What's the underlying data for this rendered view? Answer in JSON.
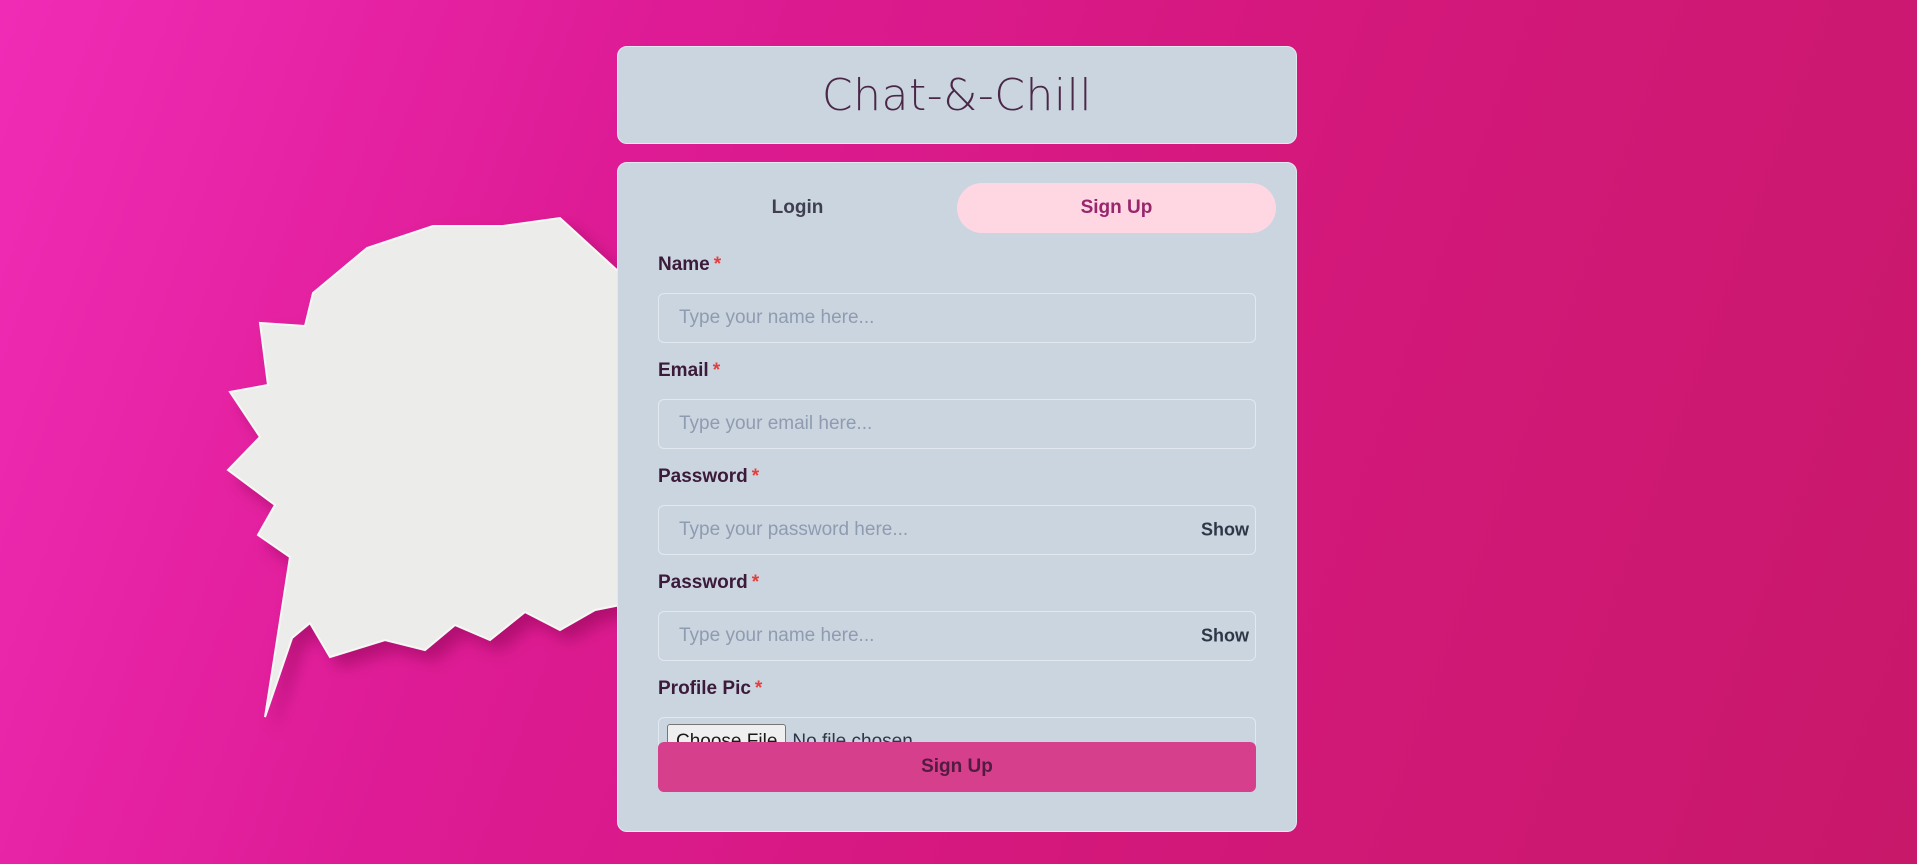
{
  "app": {
    "title": "Chat-&-Chill"
  },
  "tabs": [
    {
      "label": "Login",
      "active": false
    },
    {
      "label": "Sign Up",
      "active": true
    }
  ],
  "form": {
    "fields": [
      {
        "label": "Name",
        "required_mark": "*",
        "placeholder": "Type your name here...",
        "value": ""
      },
      {
        "label": "Email",
        "required_mark": "*",
        "placeholder": "Type your email here...",
        "value": ""
      },
      {
        "label": "Password",
        "required_mark": "*",
        "placeholder": "Type your password here...",
        "value": "",
        "toggle_label": "Show"
      },
      {
        "label": "Password",
        "required_mark": "*",
        "placeholder": "Type your name here...",
        "value": "",
        "toggle_label": "Show"
      }
    ],
    "profile_pic": {
      "label": "Profile Pic",
      "required_mark": "*",
      "choose_label": "Choose File",
      "status": "No file chosen"
    },
    "submit_label": "Sign Up"
  },
  "colors": {
    "background": "#e01c97",
    "card": "#cbd5e0",
    "active_tab": "#fed7e2",
    "submit": "#d53f8c",
    "required": "#e53e3e"
  }
}
